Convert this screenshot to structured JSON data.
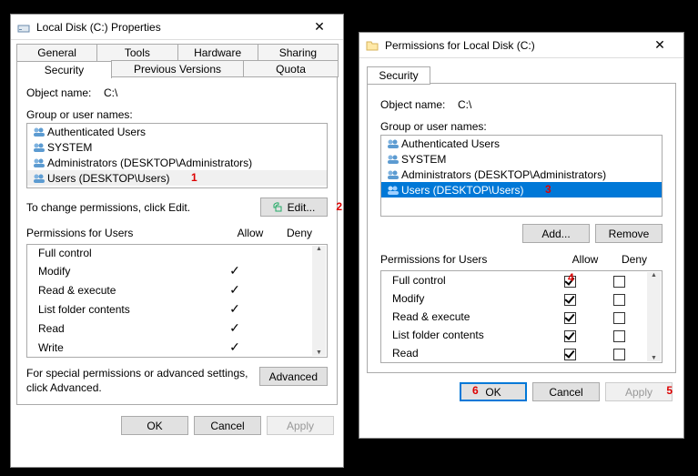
{
  "left": {
    "title": "Local Disk (C:) Properties",
    "tabs_row1": [
      "General",
      "Tools",
      "Hardware",
      "Sharing"
    ],
    "tabs_row2": [
      "Security",
      "Previous Versions",
      "Quota"
    ],
    "active_tab": "Security",
    "object_label": "Object name:",
    "object_value": "C:\\",
    "group_label": "Group or user names:",
    "groups": [
      "Authenticated Users",
      "SYSTEM",
      "Administrators (DESKTOP\\Administrators)",
      "Users (DESKTOP\\Users)"
    ],
    "edit_hint": "To change permissions, click Edit.",
    "edit_btn": "Edit...",
    "perm_header": "Permissions for Users",
    "allow": "Allow",
    "deny": "Deny",
    "perms": [
      {
        "name": "Full control",
        "allow": false,
        "deny": false
      },
      {
        "name": "Modify",
        "allow": true,
        "deny": false
      },
      {
        "name": "Read & execute",
        "allow": true,
        "deny": false
      },
      {
        "name": "List folder contents",
        "allow": true,
        "deny": false
      },
      {
        "name": "Read",
        "allow": true,
        "deny": false
      },
      {
        "name": "Write",
        "allow": true,
        "deny": false
      }
    ],
    "adv_hint": "For special permissions or advanced settings, click Advanced.",
    "adv_btn": "Advanced",
    "ok": "OK",
    "cancel": "Cancel",
    "apply": "Apply"
  },
  "right": {
    "title": "Permissions for Local Disk (C:)",
    "tab": "Security",
    "object_label": "Object name:",
    "object_value": "C:\\",
    "group_label": "Group or user names:",
    "groups": [
      "Authenticated Users",
      "SYSTEM",
      "Administrators (DESKTOP\\Administrators)",
      "Users (DESKTOP\\Users)"
    ],
    "add_btn": "Add...",
    "remove_btn": "Remove",
    "perm_header": "Permissions for Users",
    "allow": "Allow",
    "deny": "Deny",
    "perms": [
      {
        "name": "Full control",
        "allow": true,
        "deny": false
      },
      {
        "name": "Modify",
        "allow": true,
        "deny": false
      },
      {
        "name": "Read & execute",
        "allow": true,
        "deny": false
      },
      {
        "name": "List folder contents",
        "allow": true,
        "deny": false
      },
      {
        "name": "Read",
        "allow": true,
        "deny": false
      }
    ],
    "ok": "OK",
    "cancel": "Cancel",
    "apply": "Apply"
  },
  "annotations": {
    "a1": "1",
    "a2": "2",
    "a3": "3",
    "a4": "4",
    "a5": "5",
    "a6": "6"
  }
}
